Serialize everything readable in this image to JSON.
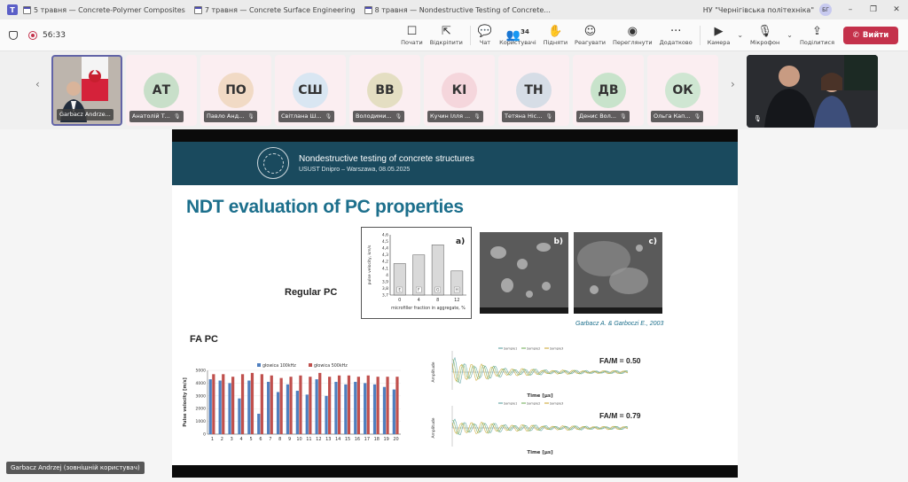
{
  "window": {
    "tabs": [
      {
        "label": "5 травня — Concrete-Polymer Composites"
      },
      {
        "label": "7 травня — Concrete Surface Engineering"
      },
      {
        "label": "8 травня — Nondestructive Testing of Concrete..."
      }
    ],
    "organization": "НУ \"Чернігівська політехніка\"",
    "avatar_initials": "БГ",
    "controls": {
      "minimize": "–",
      "restore": "❐",
      "close": "✕"
    }
  },
  "toolbar": {
    "timer": "56:33",
    "buttons": [
      {
        "label": "Почати",
        "icon": "☐"
      },
      {
        "label": "Відкріпити",
        "icon": "⇱"
      },
      {
        "label": "Чат",
        "icon": "💬"
      },
      {
        "label": "Користувачі",
        "icon": "👥",
        "count": "34"
      },
      {
        "label": "Підняти",
        "icon": "✋"
      },
      {
        "label": "Реагувати",
        "icon": "☺"
      },
      {
        "label": "Переглянути",
        "icon": "◉"
      },
      {
        "label": "Додатково",
        "icon": "···"
      }
    ],
    "camera_label": "Камера",
    "camera_icon": "▶",
    "mic_label": "Мікрофон",
    "mic_icon": "🎙",
    "share_label": "Поділитися",
    "share_icon": "⇪",
    "leave_label": "Вийти",
    "leave_icon": "✆",
    "chevron": "⌄"
  },
  "gallery": {
    "prev": "‹",
    "next": "›",
    "mic_icon": "🎙",
    "speaker": {
      "name": "Garbacz Andrze..."
    },
    "participants": [
      {
        "initials": "АТ",
        "name": "Анатолій Т...",
        "color": "#c8dfc9"
      },
      {
        "initials": "ПО",
        "name": "Павло Анд...",
        "color": "#f1dac5"
      },
      {
        "initials": "СШ",
        "name": "Світлана Ш...",
        "color": "#d9e6f2"
      },
      {
        "initials": "ВВ",
        "name": "Володими...",
        "color": "#e4dec2"
      },
      {
        "initials": "КІ",
        "name": "Кучин Ілля ...",
        "color": "#f5d6dc"
      },
      {
        "initials": "ТН",
        "name": "Тетяна Ніс...",
        "color": "#d6dde6"
      },
      {
        "initials": "ДВ",
        "name": "Денис Вол...",
        "color": "#c8e3cb"
      },
      {
        "initials": "ОК",
        "name": "Ольга Кап...",
        "color": "#cfe6d2"
      }
    ]
  },
  "slide": {
    "band_title": "Nondestructive testing of concrete structures",
    "band_subtitle": "USUST Dnipro – Warszawa, 08.05.2025",
    "heading": "NDT evaluation of PC properties",
    "regular_pc_label": "Regular PC",
    "fa_pc_label": "FA PC",
    "citation": "Garbacz A. & Garboczi E., 2003",
    "sem_labels": [
      "b)",
      "c)"
    ],
    "fam_1": "FA/M = 0.50",
    "fam_2": "FA/M = 0.79"
  },
  "caption": "Garbacz Andrzej (зовнішній користувач)",
  "chart_data": [
    {
      "type": "bar",
      "panel_label": "a)",
      "categories": [
        "0",
        "4",
        "8",
        "12"
      ],
      "bar_labels": [
        "E",
        "F",
        "G",
        "H"
      ],
      "values": [
        4.17,
        4.3,
        4.45,
        4.06
      ],
      "ylabel": "pulse velocity, km/s",
      "xlabel": "microfiller fraction in aggregate, %",
      "ylim": [
        3.7,
        4.6
      ],
      "yticks": [
        "3,7",
        "3,8",
        "3,9",
        "4",
        "4,1",
        "4,2",
        "4,3",
        "4,4",
        "4,5",
        "4,6"
      ]
    },
    {
      "type": "bar",
      "categories": [
        "1",
        "2",
        "3",
        "4",
        "5",
        "6",
        "7",
        "8",
        "9",
        "10",
        "11",
        "12",
        "13",
        "14",
        "15",
        "16",
        "17",
        "18",
        "19",
        "20"
      ],
      "series": [
        {
          "name": "głowica 100kHz",
          "color": "#4f7fbf",
          "values": [
            4300,
            4200,
            4000,
            2800,
            4200,
            1600,
            4100,
            3300,
            3900,
            3400,
            3100,
            4300,
            3000,
            4100,
            3900,
            4100,
            4000,
            3900,
            3700,
            3500
          ]
        },
        {
          "name": "głowica 500kHz",
          "color": "#c0504d",
          "values": [
            4700,
            4700,
            4500,
            4700,
            4800,
            4700,
            4600,
            4400,
            4500,
            4600,
            4500,
            4800,
            4500,
            4600,
            4600,
            4500,
            4600,
            4500,
            4500,
            4500
          ]
        }
      ],
      "ylabel": "Pulse velocity [m/s]",
      "ylim": [
        0,
        5000
      ],
      "yticks": [
        "0",
        "1000",
        "2000",
        "3000",
        "4000",
        "5000"
      ],
      "legend": "top"
    },
    {
      "type": "line",
      "xlabel": "Time [µs]",
      "ylabel": "Amplitude",
      "series_names": [
        "Sample1",
        "Sample2",
        "Sample3"
      ]
    },
    {
      "type": "line",
      "xlabel": "Time [µs]",
      "ylabel": "Amplitude",
      "series_names": [
        "Sample1",
        "Sample2",
        "Sample3"
      ]
    }
  ]
}
